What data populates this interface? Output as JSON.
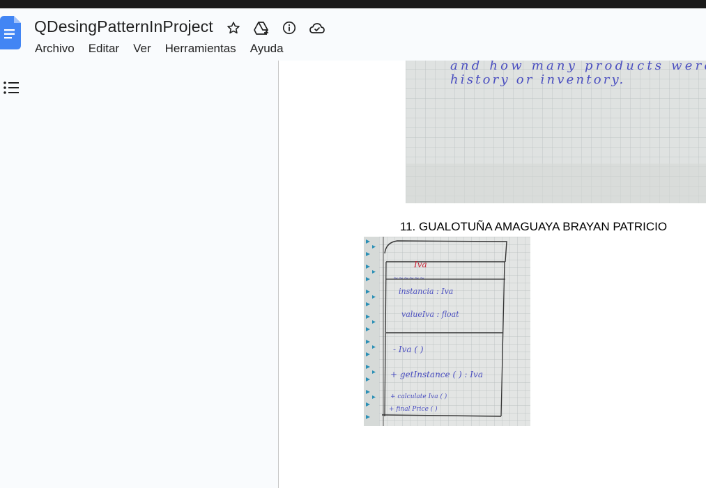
{
  "document": {
    "title": "QDesingPatternInProject"
  },
  "title_icons": [
    "star-icon",
    "move-to-drive-icon",
    "info-icon",
    "cloud-saved-icon"
  ],
  "menu": [
    "Archivo",
    "Editar",
    "Ver",
    "Herramientas",
    "Ayuda"
  ],
  "page": {
    "top_image_text": [
      "and how many products were",
      "history or inventory."
    ],
    "caption": "11. GUALOTUÑA AMAGUAYA BRAYAN PATRICIO",
    "uml": {
      "class_name": "Iva",
      "attributes": [
        "instancia : Iva",
        "valueIva : float"
      ],
      "methods": [
        "- Iva ( )",
        "+ getInstance ( ) : Iva",
        "+ calculate Iva ( )",
        "+ final Price ( )"
      ]
    }
  },
  "colors": {
    "brand_blue": "#4285f4",
    "ink_blue": "#4a4ec0",
    "ink_red": "#c8283a",
    "grid_paper": "#e6e8e6"
  }
}
